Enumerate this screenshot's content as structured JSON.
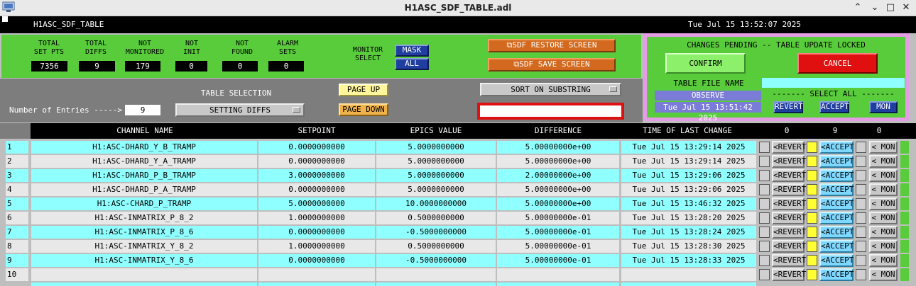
{
  "window": {
    "title": "H1ASC_SDF_TABLE.adl"
  },
  "header": {
    "name": "H1ASC_SDF_TABLE",
    "datetime": "Tue Jul 15 13:52:07 2025"
  },
  "counters": [
    {
      "label1": "TOTAL",
      "label2": "SET PTS",
      "value": "7356"
    },
    {
      "label1": "TOTAL",
      "label2": "DIFFS",
      "value": "9"
    },
    {
      "label1": "NOT",
      "label2": "MONITORED",
      "value": "179"
    },
    {
      "label1": "NOT",
      "label2": "INIT",
      "value": "0"
    },
    {
      "label1": "NOT",
      "label2": "FOUND",
      "value": "0"
    },
    {
      "label1": "ALARM",
      "label2": "SETS",
      "value": "0"
    }
  ],
  "monitor": {
    "label1": "MONITOR",
    "label2": "SELECT",
    "mask": "MASK",
    "all": "ALL"
  },
  "buttons": {
    "restore": "⧉SDF RESTORE SCREEN",
    "save": "⧉SDF SAVE SCREEN"
  },
  "pending": {
    "title": "CHANGES PENDING -- TABLE UPDATE LOCKED",
    "confirm": "CONFIRM",
    "cancel": "CANCEL",
    "file_label": "TABLE FILE NAME",
    "file_name": "OBSERVE",
    "file_time": "Tue Jul 15 13:51:42 2025",
    "select_all": "------- SELECT ALL -------",
    "revert": "REVERT",
    "accept": "ACCEPT",
    "mon": "MON"
  },
  "controls": {
    "entries_label": "Number of Entries ----->",
    "entries_value": "9",
    "table_selection": "TABLE SELECTION",
    "table_selected": "SETTING DIFFS",
    "page_up": "PAGE UP",
    "page_down": "PAGE DOWN",
    "sort": "SORT ON SUBSTRING",
    "substring": ""
  },
  "columns": {
    "channel": "CHANNEL NAME",
    "setpoint": "SETPOINT",
    "epics": "EPICS VALUE",
    "difference": "DIFFERENCE",
    "time": "TIME OF LAST CHANGE",
    "count1": "0",
    "count2": "9",
    "count3": "0"
  },
  "row_buttons": {
    "revert": "<REVERT",
    "accept": "<ACCEPT",
    "mon": "< MON"
  },
  "rows": [
    {
      "n": "1",
      "channel": "H1:ASC-DHARD_Y_B_TRAMP",
      "setpoint": "0.0000000000",
      "epics": "5.0000000000",
      "diff": "5.00000000e+00",
      "time": "Tue Jul 15 13:29:14 2025"
    },
    {
      "n": "2",
      "channel": "H1:ASC-DHARD_Y_A_TRAMP",
      "setpoint": "0.0000000000",
      "epics": "5.0000000000",
      "diff": "5.00000000e+00",
      "time": "Tue Jul 15 13:29:14 2025"
    },
    {
      "n": "3",
      "channel": "H1:ASC-DHARD_P_B_TRAMP",
      "setpoint": "3.0000000000",
      "epics": "5.0000000000",
      "diff": "2.00000000e+00",
      "time": "Tue Jul 15 13:29:06 2025"
    },
    {
      "n": "4",
      "channel": "H1:ASC-DHARD_P_A_TRAMP",
      "setpoint": "0.0000000000",
      "epics": "5.0000000000",
      "diff": "5.00000000e+00",
      "time": "Tue Jul 15 13:29:06 2025"
    },
    {
      "n": "5",
      "channel": "H1:ASC-CHARD_P_TRAMP",
      "setpoint": "5.0000000000",
      "epics": "10.0000000000",
      "diff": "5.00000000e+00",
      "time": "Tue Jul 15 13:46:32 2025"
    },
    {
      "n": "6",
      "channel": "H1:ASC-INMATRIX_P_8_2",
      "setpoint": "1.0000000000",
      "epics": "0.5000000000",
      "diff": "5.00000000e-01",
      "time": "Tue Jul 15 13:28:20 2025"
    },
    {
      "n": "7",
      "channel": "H1:ASC-INMATRIX_P_8_6",
      "setpoint": "0.0000000000",
      "epics": "-0.5000000000",
      "diff": "5.00000000e-01",
      "time": "Tue Jul 15 13:28:24 2025"
    },
    {
      "n": "8",
      "channel": "H1:ASC-INMATRIX_Y_8_2",
      "setpoint": "1.0000000000",
      "epics": "0.5000000000",
      "diff": "5.00000000e-01",
      "time": "Tue Jul 15 13:28:30 2025"
    },
    {
      "n": "9",
      "channel": "H1:ASC-INMATRIX_Y_8_6",
      "setpoint": "0.0000000000",
      "epics": "-0.5000000000",
      "diff": "5.00000000e-01",
      "time": "Tue Jul 15 13:28:33 2025"
    },
    {
      "n": "10",
      "channel": "",
      "setpoint": "",
      "epics": "",
      "diff": "",
      "time": ""
    }
  ],
  "colors": {
    "green": "#59cc3c",
    "cyan": "#90ffff",
    "row_alt": "#e8e8e8",
    "orange": "#d2691e",
    "navy": "#1f3ea0"
  }
}
